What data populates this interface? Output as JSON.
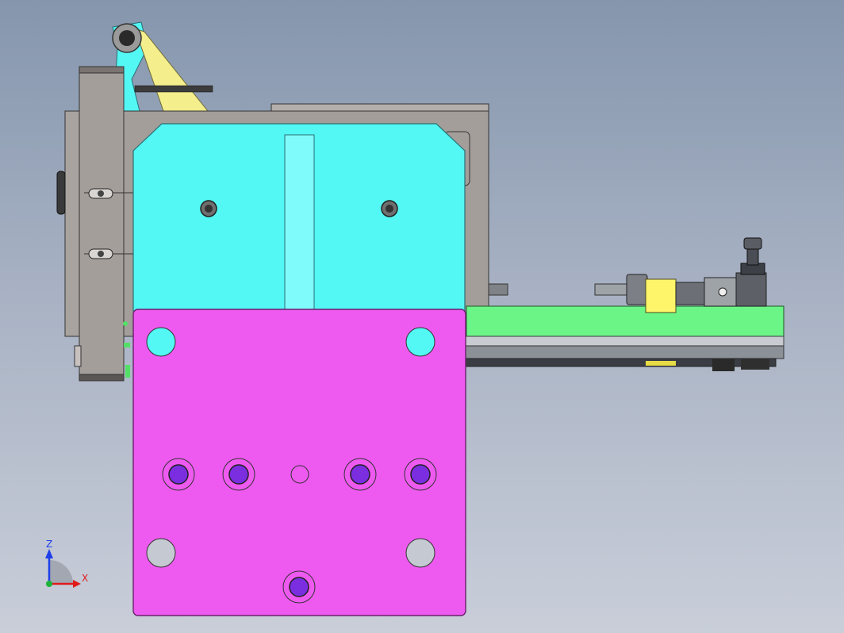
{
  "viewport": {
    "background_top": "#8596ad",
    "background_bottom": "#c9ced9"
  },
  "colors": {
    "cyan_plate": "#53f7f4",
    "cyan_slot": "#7ffbfb",
    "magenta_plate": "#ee5af0",
    "green_rail": "#6cf587",
    "yellow_block": "#fff56a",
    "frame_gray": "#a49e9a",
    "bolt_purple": "#7a2ee0",
    "axis_z": "#1f3fe8",
    "axis_x": "#e01b1b"
  },
  "triad": {
    "z_label": "Z",
    "x_label": "X"
  }
}
